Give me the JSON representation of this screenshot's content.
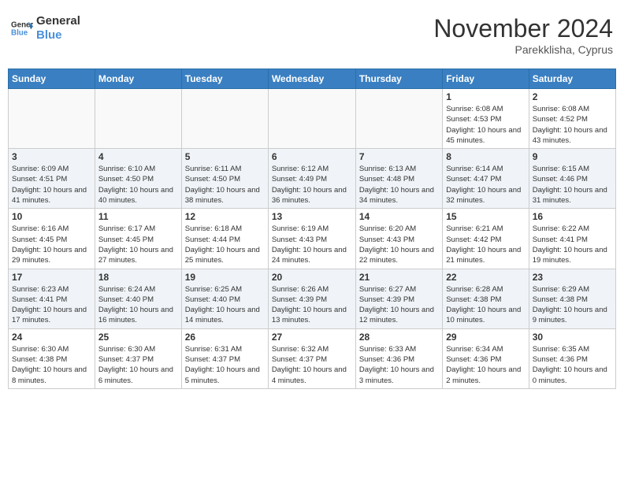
{
  "header": {
    "logo_general": "General",
    "logo_blue": "Blue",
    "month_title": "November 2024",
    "location": "Parekklisha, Cyprus"
  },
  "weekdays": [
    "Sunday",
    "Monday",
    "Tuesday",
    "Wednesday",
    "Thursday",
    "Friday",
    "Saturday"
  ],
  "weeks": [
    [
      {
        "day": "",
        "empty": true
      },
      {
        "day": "",
        "empty": true
      },
      {
        "day": "",
        "empty": true
      },
      {
        "day": "",
        "empty": true
      },
      {
        "day": "",
        "empty": true
      },
      {
        "day": "1",
        "sunrise": "6:08 AM",
        "sunset": "4:53 PM",
        "daylight": "10 hours and 45 minutes."
      },
      {
        "day": "2",
        "sunrise": "6:08 AM",
        "sunset": "4:52 PM",
        "daylight": "10 hours and 43 minutes."
      }
    ],
    [
      {
        "day": "3",
        "sunrise": "6:09 AM",
        "sunset": "4:51 PM",
        "daylight": "10 hours and 41 minutes."
      },
      {
        "day": "4",
        "sunrise": "6:10 AM",
        "sunset": "4:50 PM",
        "daylight": "10 hours and 40 minutes."
      },
      {
        "day": "5",
        "sunrise": "6:11 AM",
        "sunset": "4:50 PM",
        "daylight": "10 hours and 38 minutes."
      },
      {
        "day": "6",
        "sunrise": "6:12 AM",
        "sunset": "4:49 PM",
        "daylight": "10 hours and 36 minutes."
      },
      {
        "day": "7",
        "sunrise": "6:13 AM",
        "sunset": "4:48 PM",
        "daylight": "10 hours and 34 minutes."
      },
      {
        "day": "8",
        "sunrise": "6:14 AM",
        "sunset": "4:47 PM",
        "daylight": "10 hours and 32 minutes."
      },
      {
        "day": "9",
        "sunrise": "6:15 AM",
        "sunset": "4:46 PM",
        "daylight": "10 hours and 31 minutes."
      }
    ],
    [
      {
        "day": "10",
        "sunrise": "6:16 AM",
        "sunset": "4:45 PM",
        "daylight": "10 hours and 29 minutes."
      },
      {
        "day": "11",
        "sunrise": "6:17 AM",
        "sunset": "4:45 PM",
        "daylight": "10 hours and 27 minutes."
      },
      {
        "day": "12",
        "sunrise": "6:18 AM",
        "sunset": "4:44 PM",
        "daylight": "10 hours and 25 minutes."
      },
      {
        "day": "13",
        "sunrise": "6:19 AM",
        "sunset": "4:43 PM",
        "daylight": "10 hours and 24 minutes."
      },
      {
        "day": "14",
        "sunrise": "6:20 AM",
        "sunset": "4:43 PM",
        "daylight": "10 hours and 22 minutes."
      },
      {
        "day": "15",
        "sunrise": "6:21 AM",
        "sunset": "4:42 PM",
        "daylight": "10 hours and 21 minutes."
      },
      {
        "day": "16",
        "sunrise": "6:22 AM",
        "sunset": "4:41 PM",
        "daylight": "10 hours and 19 minutes."
      }
    ],
    [
      {
        "day": "17",
        "sunrise": "6:23 AM",
        "sunset": "4:41 PM",
        "daylight": "10 hours and 17 minutes."
      },
      {
        "day": "18",
        "sunrise": "6:24 AM",
        "sunset": "4:40 PM",
        "daylight": "10 hours and 16 minutes."
      },
      {
        "day": "19",
        "sunrise": "6:25 AM",
        "sunset": "4:40 PM",
        "daylight": "10 hours and 14 minutes."
      },
      {
        "day": "20",
        "sunrise": "6:26 AM",
        "sunset": "4:39 PM",
        "daylight": "10 hours and 13 minutes."
      },
      {
        "day": "21",
        "sunrise": "6:27 AM",
        "sunset": "4:39 PM",
        "daylight": "10 hours and 12 minutes."
      },
      {
        "day": "22",
        "sunrise": "6:28 AM",
        "sunset": "4:38 PM",
        "daylight": "10 hours and 10 minutes."
      },
      {
        "day": "23",
        "sunrise": "6:29 AM",
        "sunset": "4:38 PM",
        "daylight": "10 hours and 9 minutes."
      }
    ],
    [
      {
        "day": "24",
        "sunrise": "6:30 AM",
        "sunset": "4:38 PM",
        "daylight": "10 hours and 8 minutes."
      },
      {
        "day": "25",
        "sunrise": "6:30 AM",
        "sunset": "4:37 PM",
        "daylight": "10 hours and 6 minutes."
      },
      {
        "day": "26",
        "sunrise": "6:31 AM",
        "sunset": "4:37 PM",
        "daylight": "10 hours and 5 minutes."
      },
      {
        "day": "27",
        "sunrise": "6:32 AM",
        "sunset": "4:37 PM",
        "daylight": "10 hours and 4 minutes."
      },
      {
        "day": "28",
        "sunrise": "6:33 AM",
        "sunset": "4:36 PM",
        "daylight": "10 hours and 3 minutes."
      },
      {
        "day": "29",
        "sunrise": "6:34 AM",
        "sunset": "4:36 PM",
        "daylight": "10 hours and 2 minutes."
      },
      {
        "day": "30",
        "sunrise": "6:35 AM",
        "sunset": "4:36 PM",
        "daylight": "10 hours and 0 minutes."
      }
    ]
  ],
  "labels": {
    "sunrise": "Sunrise:",
    "sunset": "Sunset:",
    "daylight": "Daylight:"
  }
}
